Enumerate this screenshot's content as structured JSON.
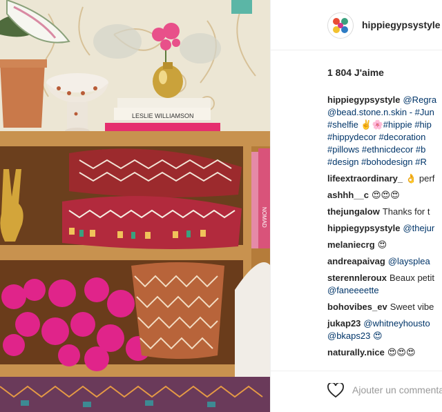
{
  "post": {
    "username": "hippiegypsystyle",
    "likes": "1 804 J'aime"
  },
  "caption": {
    "author": "hippiegypsystyle",
    "line1": "@Regra",
    "line2": "@bead.stone.n.skin - #Jun",
    "line3": "#shelfie ✌️🌸#hippie #hip",
    "line4": "#hippydecor #decoration",
    "line5": "#pillows #ethnicdecor #b",
    "line6": "#design #bohodesign #R"
  },
  "comments": [
    {
      "user": "lifeextraordinary_",
      "text": "👌 perf"
    },
    {
      "user": "ashhh__c",
      "text": "😍😍😍"
    },
    {
      "user": "thejungalow",
      "text": "Thanks for t"
    },
    {
      "user": "hippiegypsystyle",
      "text": "@thejur"
    },
    {
      "user": "melaniecrg",
      "text": "😍"
    },
    {
      "user": "andreapaivag",
      "text": "@laysplea"
    },
    {
      "user": "sterennleroux",
      "text": "Beaux petit",
      "text2": "@faneeeette"
    },
    {
      "user": "bohovibes_ev",
      "text": "Sweet vibe"
    },
    {
      "user": "jukap23",
      "text": "@whitneyhousto",
      "text2": "@bkaps23 😍"
    },
    {
      "user": "naturally.nice",
      "text": "😍😍😍"
    }
  ],
  "footer": {
    "comment_placeholder": "Ajouter un commentaire..."
  },
  "photo": {
    "book_title": "LESLIE WILLIAMSON",
    "side_book_title": "NOMAD"
  },
  "colors": {
    "link": "#003569",
    "text": "#262626",
    "muted": "#999999",
    "border": "#efefef"
  },
  "icons": [
    "heart-icon",
    "avatar-logo"
  ]
}
